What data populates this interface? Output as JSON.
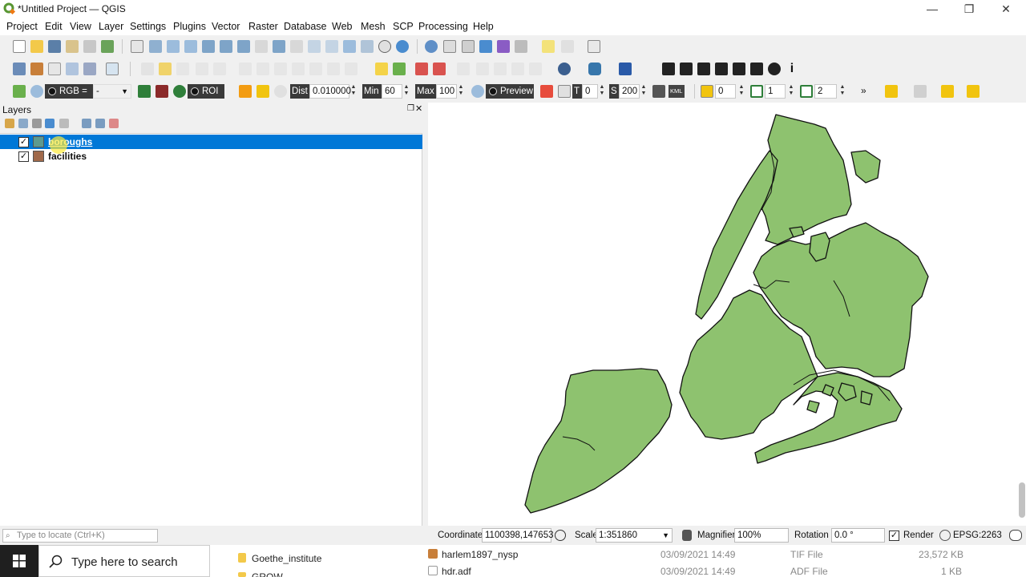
{
  "window": {
    "title": "*Untitled Project — QGIS"
  },
  "menu": [
    "Project",
    "Edit",
    "View",
    "Layer",
    "Settings",
    "Plugins",
    "Vector",
    "Raster",
    "Database",
    "Web",
    "Mesh",
    "SCP",
    "Processing",
    "Help"
  ],
  "scp_toolbar": {
    "rgb_label": "RGB =",
    "rgb_value": "-",
    "roi_label": "ROI",
    "dist_label": "Dist",
    "dist_value": "0.010000",
    "min_label": "Min",
    "min_value": "60",
    "max_label": "Max",
    "max_value": "100",
    "preview_label": "Preview",
    "t_label": "T",
    "t_value": "0",
    "s_label": "S",
    "s_value": "200",
    "kml_label": "KML",
    "n1_value": "0",
    "n2_value": "1",
    "n3_value": "2",
    "more": "»"
  },
  "layers_panel": {
    "title": "Layers",
    "layers": [
      {
        "name": "boroughs",
        "checked": "✓",
        "color": "#5e9a8e",
        "selected": true
      },
      {
        "name": "facilities",
        "checked": "✓",
        "color": "#a0694a",
        "selected": false
      }
    ]
  },
  "map": {
    "fill_color": "#8ec26f",
    "stroke_color": "#111111"
  },
  "statusbar": {
    "locator_placeholder": "Type to locate (Ctrl+K)",
    "coordinate_label": "Coordinate",
    "coordinate_value": "1100398,147653",
    "scale_label": "Scale",
    "scale_value": "1:351860",
    "magnifier_label": "Magnifier",
    "magnifier_value": "100%",
    "rotation_label": "Rotation",
    "rotation_value": "0.0 °",
    "render_label": "Render",
    "render_checked": "✓",
    "crs": "EPSG:2263"
  },
  "taskbar": {
    "search_placeholder": "Type here to search",
    "folder_items": [
      "Goethe_institute",
      "GROW"
    ],
    "files": [
      {
        "name": "harlem1897_nysp",
        "date": "03/09/2021 14:49",
        "type": "TIF File",
        "size": "23,572 KB"
      },
      {
        "name": "hdr.adf",
        "date": "03/09/2021 14:49",
        "type": "ADF File",
        "size": "1 KB"
      }
    ]
  }
}
